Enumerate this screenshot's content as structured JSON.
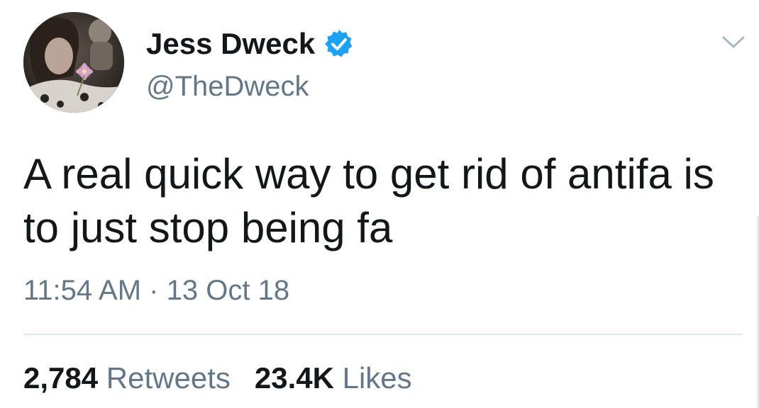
{
  "author": {
    "display_name": "Jess Dweck",
    "handle": "@TheDweck",
    "verified_icon": "verified-badge-icon",
    "verified_color": "#1da1f2"
  },
  "tweet": {
    "text": "A real quick way to get rid of antifa is to just stop being fa",
    "time": "11:54 AM",
    "separator": "·",
    "date": "13 Oct 18"
  },
  "stats": {
    "retweets_count": "2,784",
    "retweets_label": "Retweets",
    "likes_count": "23.4K",
    "likes_label": "Likes"
  },
  "menu": {
    "icon": "chevron-down-icon"
  },
  "colors": {
    "text": "#14171a",
    "secondary": "#657786",
    "divider": "#e1e8ed",
    "accent": "#1da1f2"
  }
}
